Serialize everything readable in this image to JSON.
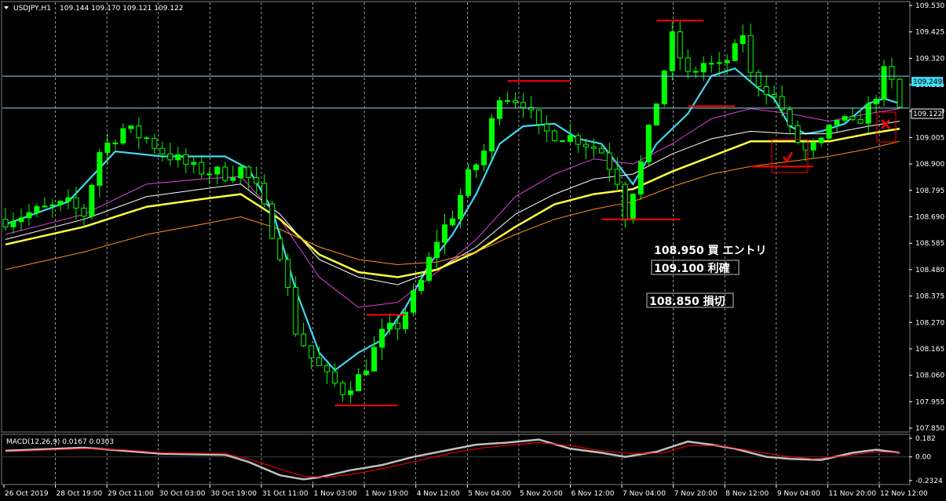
{
  "header": {
    "symbol": "USDJPY,H1",
    "ohlc": "109.144 109.170 109.121 109.122"
  },
  "macd": {
    "title": "MACD(12,26,9) 0.0167 0.0303",
    "ticks": [
      "0.182",
      "0.00",
      "-0.2324"
    ],
    "tick_values": [
      0.182,
      0.0,
      -0.2324
    ]
  },
  "price_labels": {
    "upper_line": "109.249",
    "current": "109.122"
  },
  "annotations": {
    "entry": "108.950 買 エントリ",
    "take_profit": "109.100 利確",
    "stop_loss": "108.850 損切"
  },
  "colors": {
    "bull_candle": "#00ff00",
    "ma_fast": "#40d8f0",
    "ma_slow_yellow": "#ffff40",
    "ma_magenta": "#e040e0",
    "ma_white": "#ffffff",
    "ma_orange": "#ff8c1a",
    "level_lines": "#ff0000",
    "hline": "#80e0f0",
    "macd_main": "#c0c0c0",
    "macd_signal": "#ff0000"
  },
  "chart_data": {
    "type": "candlestick",
    "symbol": "USDJPY",
    "timeframe": "H1",
    "y_ticks": [
      "109.530",
      "109.425",
      "109.320",
      "109.215",
      "109.110",
      "109.005",
      "108.900",
      "108.795",
      "108.690",
      "108.585",
      "108.480",
      "108.375",
      "108.270",
      "108.165",
      "108.060",
      "107.955",
      "107.850"
    ],
    "ylim": [
      107.85,
      109.53
    ],
    "x_ticks": [
      "26 Oct 2019",
      "28 Oct 19:00",
      "29 Oct 11:00",
      "30 Oct 03:00",
      "30 Oct 19:00",
      "31 Oct 11:00",
      "1 Nov 03:00",
      "1 Nov 19:00",
      "4 Nov 12:00",
      "5 Nov 04:00",
      "5 Nov 20:00",
      "6 Nov 12:00",
      "7 Nov 04:00",
      "7 Nov 20:00",
      "8 Nov 12:00",
      "9 Nov 04:00",
      "11 Nov 20:00",
      "12 Nov 12:00"
    ],
    "close_path": [
      [
        0,
        108.68
      ],
      [
        5,
        108.72
      ],
      [
        8,
        108.74
      ],
      [
        10,
        108.7
      ],
      [
        12,
        108.95
      ],
      [
        15,
        109.04
      ],
      [
        18,
        109.0
      ],
      [
        20,
        108.95
      ],
      [
        24,
        108.88
      ],
      [
        28,
        108.86
      ],
      [
        30,
        108.88
      ],
      [
        32,
        108.8
      ],
      [
        35,
        108.55
      ],
      [
        37,
        108.24
      ],
      [
        39,
        108.13
      ],
      [
        41,
        108.05
      ],
      [
        43,
        108.0
      ],
      [
        45,
        108.05
      ],
      [
        46,
        108.1
      ],
      [
        48,
        108.22
      ],
      [
        50,
        108.26
      ],
      [
        53,
        108.43
      ],
      [
        55,
        108.6
      ],
      [
        57,
        108.7
      ],
      [
        59,
        108.85
      ],
      [
        61,
        108.95
      ],
      [
        63,
        109.18
      ],
      [
        66,
        109.15
      ],
      [
        68,
        109.03
      ],
      [
        70,
        109.02
      ],
      [
        73,
        109.0
      ],
      [
        76,
        108.95
      ],
      [
        78,
        108.84
      ],
      [
        79,
        108.7
      ],
      [
        81,
        108.9
      ],
      [
        83,
        109.15
      ],
      [
        85,
        109.4
      ],
      [
        87,
        109.25
      ],
      [
        89,
        109.3
      ],
      [
        91,
        109.28
      ],
      [
        93,
        109.35
      ],
      [
        94,
        109.42
      ],
      [
        95,
        109.25
      ],
      [
        97,
        109.2
      ],
      [
        99,
        109.12
      ],
      [
        100,
        109.03
      ],
      [
        102,
        108.95
      ],
      [
        104,
        108.98
      ],
      [
        106,
        109.08
      ],
      [
        108,
        109.05
      ],
      [
        110,
        109.12
      ],
      [
        111,
        109.18
      ],
      [
        112,
        109.26
      ],
      [
        113,
        109.22
      ],
      [
        114,
        109.12
      ]
    ],
    "moving_averages": [
      {
        "color": "#40d8f0",
        "points": [
          [
            0,
            108.66
          ],
          [
            8,
            108.75
          ],
          [
            14,
            108.95
          ],
          [
            20,
            108.93
          ],
          [
            28,
            108.93
          ],
          [
            31,
            108.88
          ],
          [
            34,
            108.72
          ],
          [
            37,
            108.4
          ],
          [
            40,
            108.15
          ],
          [
            42,
            108.08
          ],
          [
            45,
            108.15
          ],
          [
            48,
            108.2
          ],
          [
            51,
            108.33
          ],
          [
            54,
            108.5
          ],
          [
            57,
            108.62
          ],
          [
            60,
            108.78
          ],
          [
            63,
            108.98
          ],
          [
            66,
            109.05
          ],
          [
            70,
            109.06
          ],
          [
            73,
            109.0
          ],
          [
            76,
            108.98
          ],
          [
            78,
            108.9
          ],
          [
            80,
            108.82
          ],
          [
            83,
            108.98
          ],
          [
            87,
            109.1
          ],
          [
            90,
            109.25
          ],
          [
            93,
            109.28
          ],
          [
            96,
            109.2
          ],
          [
            98,
            109.16
          ],
          [
            100,
            109.05
          ],
          [
            102,
            109.02
          ],
          [
            104,
            109.03
          ],
          [
            107,
            109.06
          ],
          [
            110,
            109.14
          ],
          [
            112,
            109.16
          ],
          [
            114,
            109.14
          ]
        ]
      },
      {
        "color": "#e040e0",
        "points": [
          [
            0,
            108.62
          ],
          [
            10,
            108.7
          ],
          [
            18,
            108.82
          ],
          [
            25,
            108.84
          ],
          [
            30,
            108.85
          ],
          [
            35,
            108.68
          ],
          [
            40,
            108.45
          ],
          [
            45,
            108.33
          ],
          [
            50,
            108.35
          ],
          [
            55,
            108.47
          ],
          [
            60,
            108.6
          ],
          [
            65,
            108.77
          ],
          [
            70,
            108.86
          ],
          [
            75,
            108.92
          ],
          [
            80,
            108.9
          ],
          [
            85,
            108.98
          ],
          [
            90,
            109.08
          ],
          [
            95,
            109.12
          ],
          [
            100,
            109.1
          ],
          [
            105,
            109.07
          ],
          [
            110,
            109.1
          ],
          [
            114,
            109.12
          ]
        ]
      },
      {
        "color": "#ffffff",
        "points": [
          [
            0,
            108.6
          ],
          [
            10,
            108.68
          ],
          [
            18,
            108.77
          ],
          [
            25,
            108.8
          ],
          [
            30,
            108.82
          ],
          [
            35,
            108.7
          ],
          [
            40,
            108.52
          ],
          [
            45,
            108.45
          ],
          [
            50,
            108.42
          ],
          [
            55,
            108.48
          ],
          [
            60,
            108.57
          ],
          [
            65,
            108.7
          ],
          [
            70,
            108.78
          ],
          [
            75,
            108.84
          ],
          [
            80,
            108.86
          ],
          [
            85,
            108.94
          ],
          [
            90,
            109.0
          ],
          [
            95,
            109.03
          ],
          [
            100,
            109.02
          ],
          [
            105,
            109.02
          ],
          [
            110,
            109.05
          ],
          [
            114,
            109.07
          ]
        ]
      },
      {
        "color": "#ffff40",
        "points": [
          [
            0,
            108.58
          ],
          [
            10,
            108.65
          ],
          [
            18,
            108.73
          ],
          [
            25,
            108.76
          ],
          [
            30,
            108.78
          ],
          [
            35,
            108.68
          ],
          [
            40,
            108.54
          ],
          [
            45,
            108.47
          ],
          [
            50,
            108.45
          ],
          [
            55,
            108.48
          ],
          [
            60,
            108.55
          ],
          [
            65,
            108.65
          ],
          [
            70,
            108.74
          ],
          [
            75,
            108.78
          ],
          [
            80,
            108.8
          ],
          [
            85,
            108.87
          ],
          [
            90,
            108.93
          ],
          [
            95,
            108.99
          ],
          [
            100,
            108.99
          ],
          [
            105,
            108.99
          ],
          [
            110,
            109.02
          ],
          [
            114,
            109.04
          ]
        ]
      },
      {
        "color": "#ff8c1a",
        "points": [
          [
            0,
            108.48
          ],
          [
            10,
            108.55
          ],
          [
            18,
            108.62
          ],
          [
            25,
            108.66
          ],
          [
            30,
            108.69
          ],
          [
            35,
            108.64
          ],
          [
            40,
            108.57
          ],
          [
            45,
            108.52
          ],
          [
            50,
            108.5
          ],
          [
            55,
            108.51
          ],
          [
            60,
            108.55
          ],
          [
            65,
            108.62
          ],
          [
            70,
            108.68
          ],
          [
            75,
            108.72
          ],
          [
            80,
            108.75
          ],
          [
            85,
            108.81
          ],
          [
            90,
            108.86
          ],
          [
            95,
            108.89
          ],
          [
            100,
            108.91
          ],
          [
            105,
            108.93
          ],
          [
            110,
            108.96
          ],
          [
            114,
            108.99
          ]
        ]
      }
    ],
    "red_levels": [
      {
        "y": 107.94,
        "x0": 42,
        "x1": 50
      },
      {
        "y": 108.3,
        "x0": 46,
        "x1": 51
      },
      {
        "y": 109.23,
        "x0": 64,
        "x1": 72
      },
      {
        "y": 109.47,
        "x0": 83,
        "x1": 89
      },
      {
        "y": 108.68,
        "x0": 76,
        "x1": 86
      },
      {
        "y": 109.13,
        "x0": 87,
        "x1": 93
      },
      {
        "y": 108.89,
        "x0": 95,
        "x1": 103
      }
    ],
    "horizontal_lines": [
      109.249,
      109.122
    ],
    "macd_series": {
      "main": [
        [
          0,
          0.06
        ],
        [
          10,
          0.09
        ],
        [
          15,
          0.06
        ],
        [
          20,
          0.03
        ],
        [
          28,
          0.02
        ],
        [
          31,
          -0.05
        ],
        [
          35,
          -0.18
        ],
        [
          38,
          -0.22
        ],
        [
          40,
          -0.2
        ],
        [
          44,
          -0.13
        ],
        [
          48,
          -0.08
        ],
        [
          52,
          0.0
        ],
        [
          56,
          0.06
        ],
        [
          60,
          0.12
        ],
        [
          64,
          0.14
        ],
        [
          68,
          0.17
        ],
        [
          72,
          0.08
        ],
        [
          76,
          0.04
        ],
        [
          79,
          0.0
        ],
        [
          83,
          0.05
        ],
        [
          87,
          0.15
        ],
        [
          90,
          0.12
        ],
        [
          93,
          0.08
        ],
        [
          97,
          0.0
        ],
        [
          100,
          -0.02
        ],
        [
          104,
          -0.03
        ],
        [
          108,
          0.04
        ],
        [
          111,
          0.07
        ],
        [
          114,
          0.04
        ]
      ],
      "signal": [
        [
          0,
          0.05
        ],
        [
          10,
          0.08
        ],
        [
          15,
          0.07
        ],
        [
          20,
          0.04
        ],
        [
          28,
          0.03
        ],
        [
          31,
          -0.02
        ],
        [
          35,
          -0.12
        ],
        [
          38,
          -0.19
        ],
        [
          41,
          -0.2
        ],
        [
          45,
          -0.16
        ],
        [
          49,
          -0.1
        ],
        [
          53,
          -0.03
        ],
        [
          57,
          0.04
        ],
        [
          61,
          0.09
        ],
        [
          65,
          0.12
        ],
        [
          68,
          0.14
        ],
        [
          72,
          0.11
        ],
        [
          76,
          0.06
        ],
        [
          80,
          0.03
        ],
        [
          84,
          0.04
        ],
        [
          87,
          0.11
        ],
        [
          91,
          0.11
        ],
        [
          95,
          0.06
        ],
        [
          99,
          0.01
        ],
        [
          103,
          -0.02
        ],
        [
          107,
          0.01
        ],
        [
          111,
          0.05
        ],
        [
          114,
          0.04
        ]
      ],
      "ylim": [
        -0.2324,
        0.182
      ]
    }
  }
}
